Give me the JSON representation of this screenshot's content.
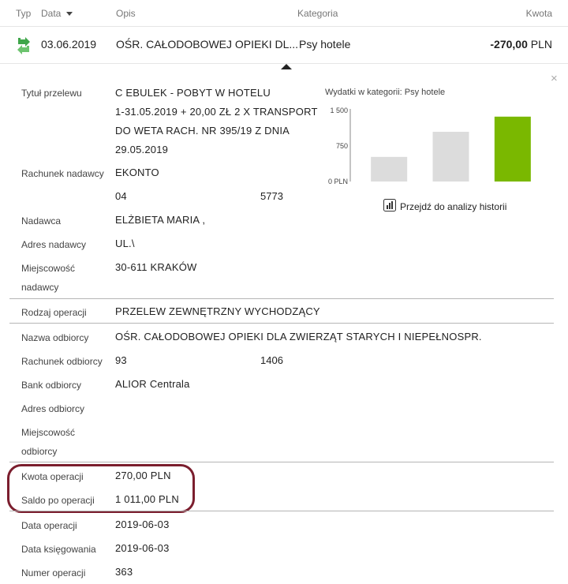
{
  "header": {
    "typ": "Typ",
    "data": "Data",
    "opis": "Opis",
    "kategoria": "Kategoria",
    "kwota": "Kwota"
  },
  "transaction": {
    "date": "03.06.2019",
    "opis": "OŚR. CAŁODOBOWEJ OPIEKI DL...",
    "kategoria": "Psy hotele",
    "amount": "-270,00",
    "currency": "PLN",
    "icon": "transfer-out-icon",
    "icon_color": "#4caf50"
  },
  "details": {
    "tytul_label": "Tytuł przelewu",
    "tytul_lines": [
      "C EBULEK - POBYT W HOTELU",
      "1-31.05.2019 + 20,00 ZŁ 2 X TRANSPORT",
      "DO WETA RACH. NR 395/19 Z DNIA",
      "29.05.2019"
    ],
    "rachunek_nadawcy_label": "Rachunek nadawcy",
    "rachunek_nadawcy": "EKONTO",
    "rachunek_nadawcy_num_a": "04",
    "rachunek_nadawcy_num_b": "5773",
    "nadawca_label": "Nadawca",
    "nadawca": "ELŻBIETA MARIA ,",
    "adres_nadawcy_label": "Adres nadawcy",
    "adres_nadawcy": "UL.\\",
    "miejscowosc_nadawcy_label_1": "Miejscowość",
    "miejscowosc_nadawcy_label_2": "nadawcy",
    "miejscowosc_nadawcy": "30-611 KRAKÓW",
    "rodzaj_label": "Rodzaj operacji",
    "rodzaj": "PRZELEW ZEWNĘTRZNY WYCHODZĄCY",
    "nazwa_odbiorcy_label": "Nazwa odbiorcy",
    "nazwa_odbiorcy": "OŚR. CAŁODOBOWEJ OPIEKI DLA ZWIERZĄT STARYCH I NIEPEŁNOSPR.",
    "rachunek_odbiorcy_label": "Rachunek odbiorcy",
    "rachunek_odbiorcy_a": "93",
    "rachunek_odbiorcy_b": "1406",
    "bank_odbiorcy_label": "Bank odbiorcy",
    "bank_odbiorcy": "ALIOR Centrala",
    "adres_odbiorcy_label": "Adres odbiorcy",
    "miejscowosc_odbiorcy_label_1": "Miejscowość",
    "miejscowosc_odbiorcy_label_2": "odbiorcy",
    "kwota_operacji_label": "Kwota operacji",
    "kwota_operacji": "270,00 PLN",
    "saldo_label": "Saldo po operacji",
    "saldo": "1 011,00 PLN",
    "data_operacji_label": "Data operacji",
    "data_operacji": "2019-06-03",
    "data_ksiegowania_label": "Data księgowania",
    "data_ksiegowania": "2019-06-03",
    "numer_label": "Numer operacji",
    "numer": "363"
  },
  "side": {
    "chart_title": "Wydatki w kategorii:",
    "chart_category": "Psy hotele",
    "analysis_link": "Przejdź do analizy historii",
    "close_symbol": "×"
  },
  "chart_data": {
    "type": "bar",
    "categories": [
      "",
      "",
      ""
    ],
    "values": [
      520,
      1050,
      1370
    ],
    "colors": [
      "#dcdcdc",
      "#dcdcdc",
      "#7ab800"
    ],
    "ylim": [
      0,
      1500
    ],
    "yticks": [
      0,
      750,
      1500
    ],
    "ytick_labels": [
      "0 PLN",
      "750",
      "1 500"
    ],
    "grid": false
  }
}
